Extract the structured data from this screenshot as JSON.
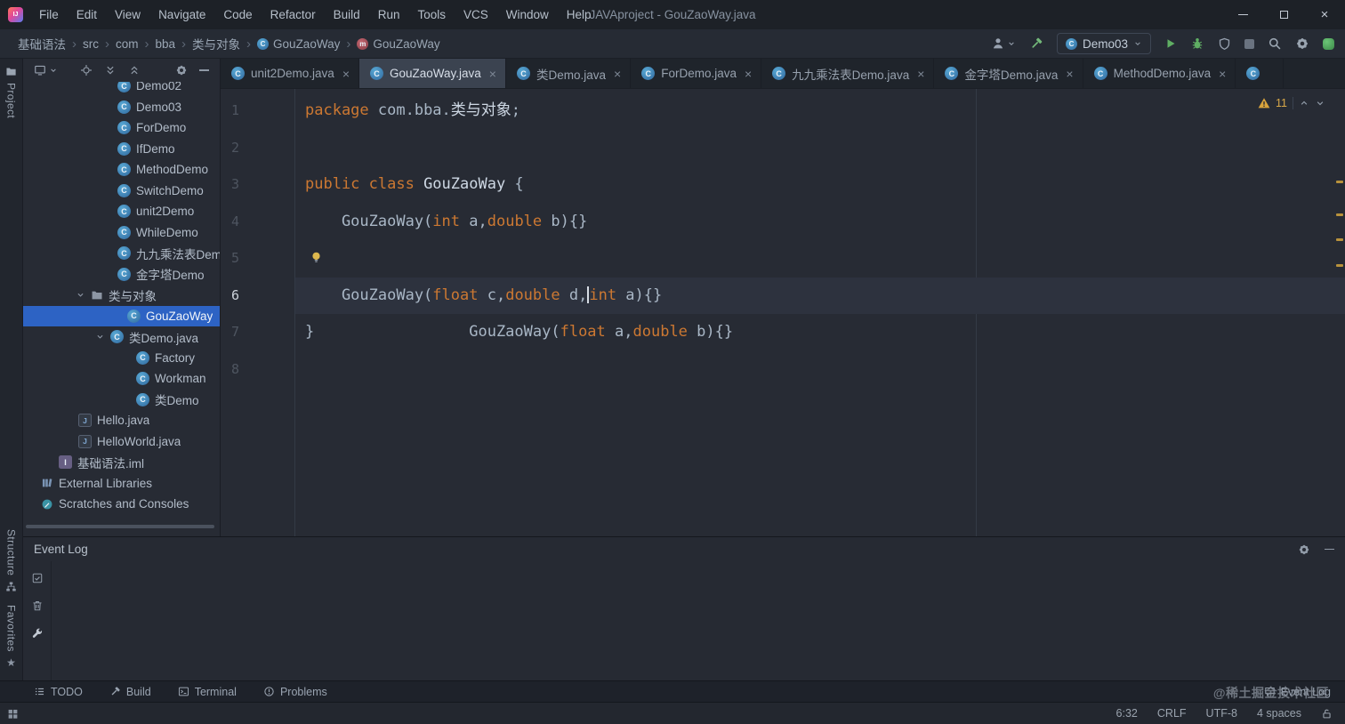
{
  "titlebar": {
    "menus": [
      "File",
      "Edit",
      "View",
      "Navigate",
      "Code",
      "Refactor",
      "Build",
      "Run",
      "Tools",
      "VCS",
      "Window",
      "Help"
    ],
    "title": "JAVAproject - GouZaoWay.java"
  },
  "navbar": {
    "breadcrumbs": [
      {
        "label": "基础语法"
      },
      {
        "label": "src"
      },
      {
        "label": "com"
      },
      {
        "label": "bba"
      },
      {
        "label": "类与对象"
      },
      {
        "label": "GouZaoWay",
        "icon": "class-icon"
      },
      {
        "label": "GouZaoWay",
        "icon": "method-icon"
      }
    ],
    "run_config": {
      "label": "Demo03",
      "icon": "class-icon"
    }
  },
  "stripe": {
    "project": "Project",
    "structure": "Structure",
    "favorites": "Favorites"
  },
  "project_panel": {
    "tree": [
      {
        "label": "Demo02",
        "icon": "class-icon"
      },
      {
        "label": "Demo03",
        "icon": "class-icon"
      },
      {
        "label": "ForDemo",
        "icon": "class-icon"
      },
      {
        "label": "IfDemo",
        "icon": "class-icon"
      },
      {
        "label": "MethodDemo",
        "icon": "class-icon"
      },
      {
        "label": "SwitchDemo",
        "icon": "class-icon"
      },
      {
        "label": "unit2Demo",
        "icon": "class-icon"
      },
      {
        "label": "WhileDemo",
        "icon": "class-icon"
      },
      {
        "label": "九九乘法表Dem",
        "icon": "class-icon"
      },
      {
        "label": "金字塔Demo",
        "icon": "class-icon"
      },
      {
        "label": "类与对象",
        "icon": "package-folder-icon",
        "expanded": true
      },
      {
        "label": "GouZaoWay",
        "icon": "class-icon",
        "selected": true
      },
      {
        "label": "类Demo.java",
        "icon": "class-icon",
        "expanded": true
      },
      {
        "label": "Factory",
        "icon": "class-icon"
      },
      {
        "label": "Workman",
        "icon": "class-icon"
      },
      {
        "label": "类Demo",
        "icon": "class-icon"
      },
      {
        "label": "Hello.java",
        "icon": "java-file-icon"
      },
      {
        "label": "HelloWorld.java",
        "icon": "java-file-icon"
      },
      {
        "label": "基础语法.iml",
        "icon": "iml-file-icon"
      },
      {
        "label": "External Libraries",
        "icon": "library-icon"
      },
      {
        "label": "Scratches and Consoles",
        "icon": "scratches-icon"
      }
    ]
  },
  "tabs": [
    {
      "label": "unit2Demo.java",
      "icon": "class-icon",
      "active": false
    },
    {
      "label": "GouZaoWay.java",
      "icon": "class-icon",
      "active": true
    },
    {
      "label": "类Demo.java",
      "icon": "class-icon",
      "active": false
    },
    {
      "label": "ForDemo.java",
      "icon": "class-icon",
      "active": false
    },
    {
      "label": "九九乘法表Demo.java",
      "icon": "class-icon",
      "active": false
    },
    {
      "label": "金字塔Demo.java",
      "icon": "class-icon",
      "active": false
    },
    {
      "label": "MethodDemo.java",
      "icon": "class-icon",
      "active": false
    }
  ],
  "editor": {
    "line_numbers": [
      "1",
      "2",
      "3",
      "4",
      "5",
      "6",
      "7",
      "8"
    ],
    "current_line": 6,
    "warning_count": "11",
    "lines": [
      {
        "segments": [
          {
            "t": "package ",
            "c": "k"
          },
          {
            "t": "com.bba.",
            "c": "p"
          },
          {
            "t": "类与对象",
            "c": "w"
          },
          {
            "t": ";",
            "c": "p"
          }
        ]
      },
      {
        "segments": []
      },
      {
        "segments": [
          {
            "t": "public class ",
            "c": "k"
          },
          {
            "t": "GouZaoWay ",
            "c": "w"
          },
          {
            "t": "{",
            "c": "p"
          }
        ]
      },
      {
        "segments": [
          {
            "t": "    GouZaoWay(",
            "c": "p"
          },
          {
            "t": "int",
            "c": "k"
          },
          {
            "t": " a,",
            "c": "p"
          },
          {
            "t": "double",
            "c": "k"
          },
          {
            "t": " b){}",
            "c": "p"
          }
        ]
      },
      {
        "segments": [
          {
            "t": "    GouZaoWay(",
            "c": "p"
          },
          {
            "t": "float",
            "c": "k"
          },
          {
            "t": " a,",
            "c": "p"
          },
          {
            "t": "double",
            "c": "k"
          },
          {
            "t": " b){}",
            "c": "p"
          }
        ]
      },
      {
        "segments": [
          {
            "t": "    GouZaoWay(",
            "c": "p"
          },
          {
            "t": "float",
            "c": "k"
          },
          {
            "t": " c,",
            "c": "p"
          },
          {
            "t": "double",
            "c": "k"
          },
          {
            "t": " d,",
            "c": "p"
          },
          {
            "caret": true
          },
          {
            "t": "int",
            "c": "k"
          },
          {
            "t": " a){}",
            "c": "p"
          }
        ]
      },
      {
        "segments": [
          {
            "t": "}",
            "c": "p"
          }
        ]
      },
      {
        "segments": []
      }
    ]
  },
  "event_log": {
    "title": "Event Log"
  },
  "bottom_bar": {
    "todo": "TODO",
    "build": "Build",
    "terminal": "Terminal",
    "problems": "Problems",
    "event_log": "Event Log",
    "watermark": "@稀土掘金技术社区"
  },
  "status_bar": {
    "caret_position": "6:32",
    "line_separator": "CRLF",
    "encoding": "UTF-8",
    "indent": "4 spaces"
  }
}
